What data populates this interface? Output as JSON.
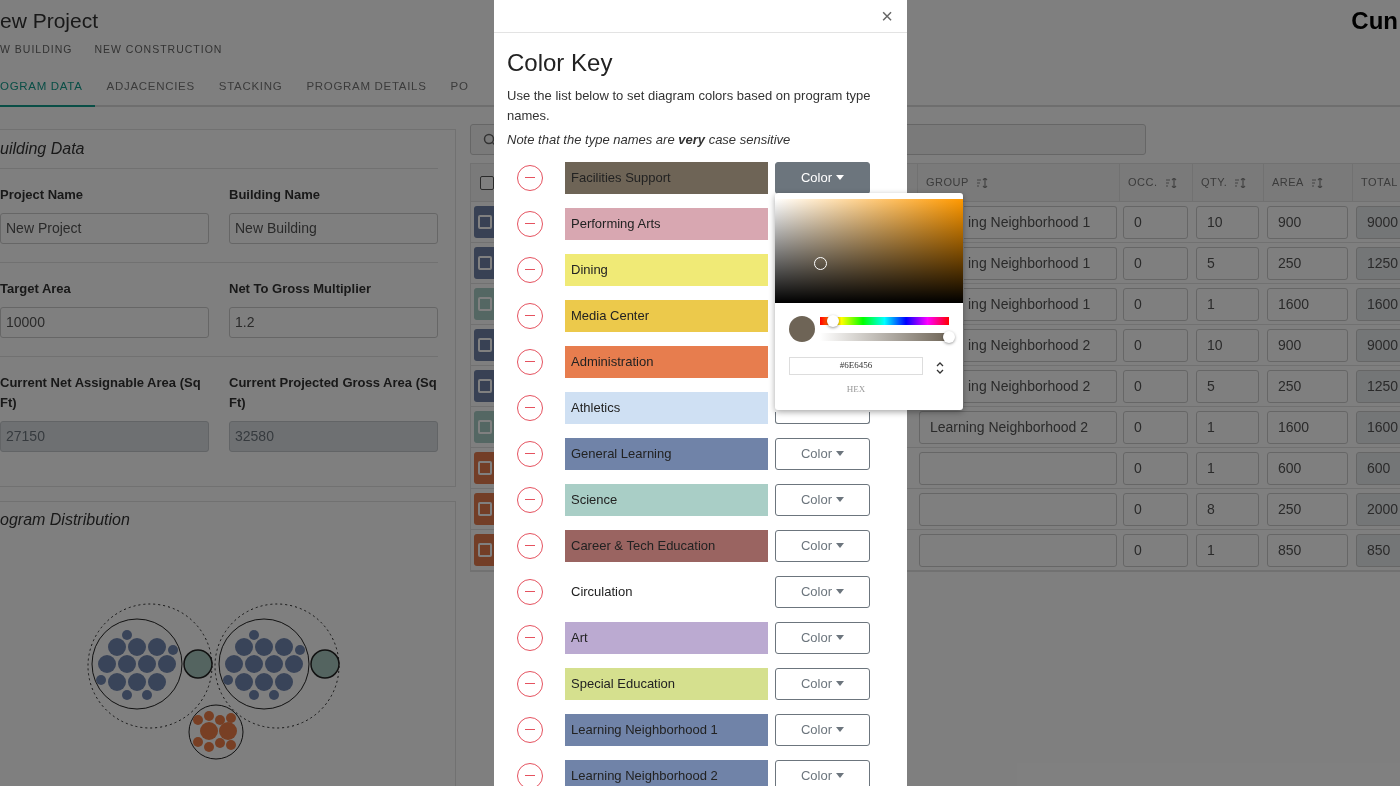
{
  "header": {
    "title": "ew Project",
    "subtitles": [
      "W BUILDING",
      "NEW CONSTRUCTION"
    ],
    "logo": "Cun"
  },
  "tabs": [
    {
      "label": "OGRAM DATA",
      "selected": true
    },
    {
      "label": "ADJACENCIES",
      "selected": false
    },
    {
      "label": "STACKING",
      "selected": false
    },
    {
      "label": "PROGRAM DETAILS",
      "selected": false
    },
    {
      "label": "PO",
      "selected": false
    }
  ],
  "building_data": {
    "title": "uilding Data",
    "fields": [
      {
        "label": "Project Name",
        "value": "New Project",
        "readonly": false
      },
      {
        "label": "Building Name",
        "value": "New Building",
        "readonly": false
      },
      {
        "label": "Target Area",
        "value": "10000",
        "readonly": false
      },
      {
        "label": "Net To Gross Multiplier",
        "value": "1.2",
        "readonly": false
      },
      {
        "label": "Current Net Assignable Area (Sq Ft)",
        "value": "27150",
        "readonly": true
      },
      {
        "label": "Current Projected Gross Area (Sq Ft)",
        "value": "32580",
        "readonly": true
      }
    ]
  },
  "program_distribution": {
    "title": "ogram Distribution"
  },
  "table": {
    "all_selected": false,
    "columns": [
      {
        "label": "GROUP",
        "sort": true
      },
      {
        "label": "OCC.",
        "sort": true
      },
      {
        "label": "QTY.",
        "sort": true
      },
      {
        "label": "AREA",
        "sort": true
      },
      {
        "label": "TOTAL"
      }
    ],
    "rows": [
      {
        "color": "#384154",
        "group": "ing Neighborhood 1",
        "partly_covered": true,
        "occ": "0",
        "qty": "10",
        "area": "900",
        "total": "9000"
      },
      {
        "color": "#384154",
        "group": "ing Neighborhood 1",
        "partly_covered": true,
        "occ": "0",
        "qty": "5",
        "area": "250",
        "total": "1250"
      },
      {
        "color": "#546763",
        "group": "ing Neighborhood 1",
        "partly_covered": true,
        "occ": "0",
        "qty": "1",
        "area": "1600",
        "total": "1600"
      },
      {
        "color": "#384154",
        "group": "ing Neighborhood 2",
        "partly_covered": true,
        "occ": "0",
        "qty": "10",
        "area": "900",
        "total": "9000"
      },
      {
        "color": "#384154",
        "group": "ing Neighborhood 2",
        "partly_covered": true,
        "occ": "0",
        "qty": "5",
        "area": "250",
        "total": "1250"
      },
      {
        "color": "#546763",
        "group": "Learning Neighborhood 2",
        "partly_covered": false,
        "occ": "0",
        "qty": "1",
        "area": "1600",
        "total": "1600"
      },
      {
        "color": "#733e27",
        "occ": "0",
        "qty": "1",
        "area": "600",
        "total": "600"
      },
      {
        "color": "#733e27",
        "occ": "0",
        "qty": "8",
        "area": "250",
        "total": "2000"
      },
      {
        "color": "#733e27",
        "occ": "0",
        "qty": "1",
        "area": "850",
        "total": "850"
      }
    ]
  },
  "modal": {
    "close": "×",
    "title": "Color Key",
    "description": "Use the list below to set diagram colors based on program type names.",
    "note": "Note that the type names are **very** case sensitive",
    "items": [
      {
        "name": "Facilities Support",
        "color": "#6e6456",
        "kind": "button",
        "button": "Color",
        "selected": true
      },
      {
        "name": "Performing Arts",
        "color": "#d8a7b1",
        "kind": "covered"
      },
      {
        "name": "Dining",
        "color": "#f0ea76",
        "kind": "covered"
      },
      {
        "name": "Media Center",
        "color": "#ecc94b",
        "kind": "covered"
      },
      {
        "name": "Administration",
        "color": "#e77d4e",
        "kind": "covered"
      },
      {
        "name": "Athletics",
        "color": "#cfe0f3",
        "kind": "edge"
      },
      {
        "name": "General Learning",
        "color": "#7083a8",
        "kind": "button",
        "button": "Color",
        "selected": false
      },
      {
        "name": "Science",
        "color": "#a9cec6",
        "kind": "button",
        "button": "Color",
        "selected": false
      },
      {
        "name": "Career & Tech Education",
        "color": "#9a6461",
        "kind": "button",
        "button": "Color",
        "selected": false
      },
      {
        "name": "Circulation",
        "color": "#ffffff",
        "kind": "button",
        "button": "Color",
        "selected": false
      },
      {
        "name": "Art",
        "color": "#bbaad1",
        "kind": "button",
        "button": "Color",
        "selected": false
      },
      {
        "name": "Special Education",
        "color": "#d5e08e",
        "kind": "button",
        "button": "Color",
        "selected": false
      },
      {
        "name": "Learning Neighborhood 1",
        "color": "#7083a8",
        "kind": "button",
        "button": "Color",
        "selected": false
      },
      {
        "name": "Learning Neighborhood 2",
        "color": "#7083a8",
        "kind": "button",
        "button": "Color",
        "selected": false
      }
    ]
  },
  "picker": {
    "hex": "#6E6456",
    "mode": "HEX",
    "hue": {
      "level": 0.1
    },
    "alpha": {
      "level": 1
    }
  }
}
